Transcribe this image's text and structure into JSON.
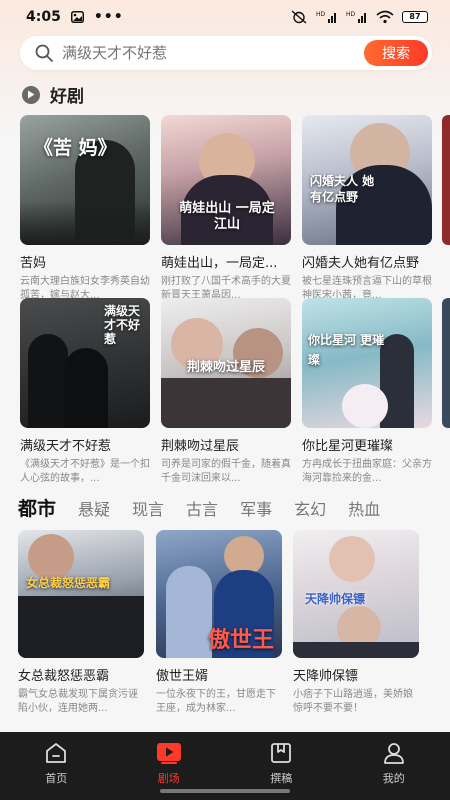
{
  "status": {
    "time": "4:05",
    "battery": "87"
  },
  "search": {
    "placeholder": "满级天才不好惹",
    "button": "搜索"
  },
  "section": {
    "title": "好剧"
  },
  "dramas": [
    {
      "title": "苦妈",
      "desc": "云南大理白族妇女李秀英自幼孤苦，嫁与赵大...",
      "poster_text": "《苦 妈》"
    },
    {
      "title": "萌娃出山，一局定...",
      "desc": "刚打败了八国千术高手的大夏新晋天王萧晶因...",
      "poster_text": "萌娃出山 一局定江山"
    },
    {
      "title": "闪婚夫人她有亿点野",
      "desc": "被七星连珠预言逼下山的草根神医宋小茜，竟...",
      "poster_text": "闪婚夫人 她有亿点野"
    },
    {
      "title": "满级天才不好惹",
      "desc": "《满级天才不好惹》是一个扣人心弦的故事，...",
      "poster_text": "满级天才不好惹"
    },
    {
      "title": "荆棘吻过星辰",
      "desc": "司养是司家的假千金，随着真千金司沫回来以...",
      "poster_text": "荆棘吻过星辰"
    },
    {
      "title": "你比星河更璀璨",
      "desc": "方冉成长于扭曲家庭：父亲方海河靠捡来的金...",
      "poster_text": "你比星河 更璀璨"
    }
  ],
  "tabs": [
    "都市",
    "悬疑",
    "现言",
    "古言",
    "军事",
    "玄幻",
    "热血"
  ],
  "city_dramas": [
    {
      "title": "女总裁怒惩恶霸",
      "desc": "霸气女总裁发现下属贪污诬陷小伙，连用她两...",
      "poster_text": "女总裁怒惩恶霸"
    },
    {
      "title": "傲世王婿",
      "desc": "一位永夜下的王，甘愿走下王座，成为林家...",
      "poster_text": "傲世王婿"
    },
    {
      "title": "天降帅保镖",
      "desc": "小痞子下山路逍遥，美娇娘惊呼不要不要！",
      "poster_text": "天降帅保镖"
    }
  ],
  "nav": [
    {
      "label": "首页",
      "icon": "home-icon"
    },
    {
      "label": "剧场",
      "icon": "video-play-icon"
    },
    {
      "label": "撰稿",
      "icon": "bookmark-icon"
    },
    {
      "label": "我的",
      "icon": "user-icon"
    }
  ],
  "colors": {
    "accent": "#ff3a2a",
    "nav_bg": "#1c1c1c"
  }
}
